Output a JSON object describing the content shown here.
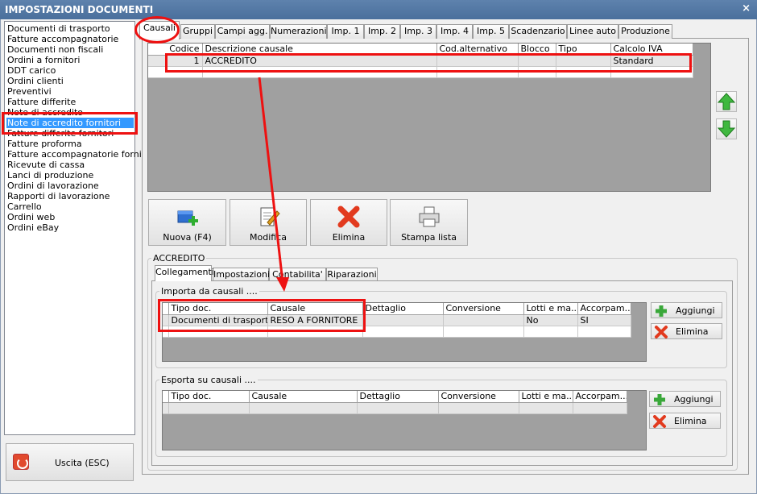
{
  "window": {
    "title": "IMPOSTAZIONI DOCUMENTI",
    "close": "×"
  },
  "document_types": [
    "Documenti di trasporto",
    "Fatture accompagnatorie",
    "Documenti non fiscali",
    "Ordini a fornitori",
    "DDT carico",
    "Ordini clienti",
    "Preventivi",
    "Fatture differite",
    "Note di accredito",
    "Note di accredito fornitori",
    "Fatture differite fornitori",
    "Fatture proforma",
    "Fatture accompagnatorie fornito",
    "Ricevute di cassa",
    "Lanci di produzione",
    "Ordini di lavorazione",
    "Rapporti di lavorazione",
    "Carrello",
    "Ordini web",
    "Ordini eBay"
  ],
  "selected_document": "Note di accredito fornitori",
  "exit_button": "Uscita (ESC)",
  "tabs": [
    "Causali",
    "Gruppi",
    "Campi agg.",
    "Numerazioni",
    "Imp. 1",
    "Imp. 2",
    "Imp. 3",
    "Imp. 4",
    "Imp. 5",
    "Scadenzario",
    "Linee auto",
    "Produzione"
  ],
  "causali_grid": {
    "columns": [
      "Codice",
      "Descrizione causale",
      "Cod.alternativo",
      "Blocco",
      "Tipo",
      "Calcolo IVA"
    ],
    "rows": [
      [
        "1",
        "ACCREDITO",
        "",
        "",
        "",
        "Standard"
      ]
    ]
  },
  "toolbar": {
    "nuova": "Nuova (F4)",
    "modifica": "Modifica",
    "elimina": "Elimina",
    "stampa": "Stampa lista"
  },
  "selected_causale": "ACCREDITO",
  "subtabs": [
    "Collegamenti",
    "Impostazioni",
    "Contabilita'",
    "Riparazioni"
  ],
  "importa": {
    "title": "Importa da causali ....",
    "columns": [
      "Tipo doc.",
      "Causale",
      "Dettaglio",
      "Conversione",
      "Lotti e ma...",
      "Accorpam..."
    ],
    "rows": [
      [
        "Documenti di trasporto",
        "RESO A FORNITORE",
        "",
        "",
        "No",
        "SI"
      ]
    ],
    "add": "Aggiungi",
    "remove": "Elimina"
  },
  "esporta": {
    "title": "Esporta su causali ....",
    "columns": [
      "Tipo doc.",
      "Causale",
      "Dettaglio",
      "Conversione",
      "Lotti e ma...",
      "Accorpam..."
    ],
    "rows": [],
    "add": "Aggiungi",
    "remove": "Elimina"
  },
  "colors": {
    "titlebar": "#4a6f9c",
    "selection": "#3399ff",
    "annotation": "#ee1111",
    "grid_bg": "#a0a0a0"
  }
}
